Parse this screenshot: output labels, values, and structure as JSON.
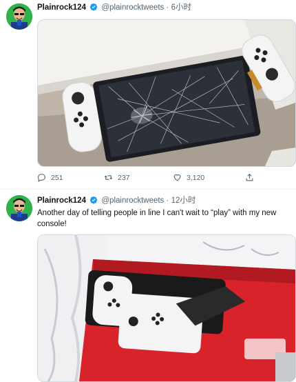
{
  "tweets": [
    {
      "name": "Plainrock124",
      "handle": "@plainrocktweets",
      "separator": "·",
      "time": "6小时",
      "text": "",
      "media_icon": "photo-broken-switch-oled",
      "stats": {
        "replies": "251",
        "retweets": "237",
        "likes": "3,120"
      }
    },
    {
      "name": "Plainrock124",
      "handle": "@plainrocktweets",
      "separator": "·",
      "time": "12小时",
      "text": "Another day of telling people in line I can't wait to “play” with my new console!",
      "media_icon": "photo-switch-oled-box"
    }
  ],
  "icons": {
    "reply": "reply-icon",
    "retweet": "retweet-icon",
    "like": "heart-icon",
    "share": "share-icon",
    "verified": "verified-badge-icon"
  },
  "colors": {
    "verified": "#1d9bf0",
    "secondary_text": "#536471",
    "avatar_bg": "#2fb24a",
    "switch_red": "#d8232a"
  }
}
